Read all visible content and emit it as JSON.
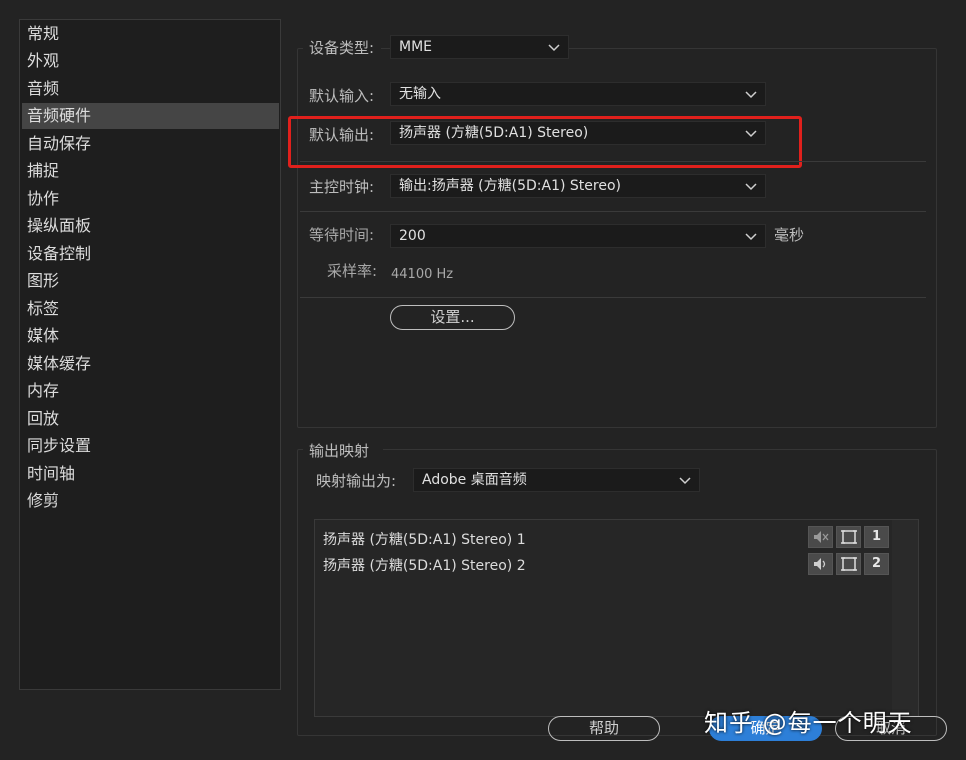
{
  "sidebar": {
    "items": [
      {
        "label": "常规"
      },
      {
        "label": "外观"
      },
      {
        "label": "音频"
      },
      {
        "label": "音频硬件"
      },
      {
        "label": "自动保存"
      },
      {
        "label": "捕捉"
      },
      {
        "label": "协作"
      },
      {
        "label": "操纵面板"
      },
      {
        "label": "设备控制"
      },
      {
        "label": "图形"
      },
      {
        "label": "标签"
      },
      {
        "label": "媒体"
      },
      {
        "label": "媒体缓存"
      },
      {
        "label": "内存"
      },
      {
        "label": "回放"
      },
      {
        "label": "同步设置"
      },
      {
        "label": "时间轴"
      },
      {
        "label": "修剪"
      }
    ],
    "active_index": 3
  },
  "device": {
    "device_type_label": "设备类型:",
    "device_type_value": "MME",
    "default_input_label": "默认输入:",
    "default_input_value": "无输入",
    "default_output_label": "默认输出:",
    "default_output_value": "扬声器 (方糖(5D:A1) Stereo)",
    "master_clock_label": "主控时钟:",
    "master_clock_value": "输出:扬声器 (方糖(5D:A1) Stereo)",
    "latency_label": "等待时间:",
    "latency_value": "200",
    "latency_unit": "毫秒",
    "sample_rate_label": "采样率:",
    "sample_rate_value": "44100 Hz",
    "settings_button": "设置..."
  },
  "output_map": {
    "section_title": "输出映射",
    "map_output_label": "映射输出为:",
    "map_output_value": "Adobe 桌面音频",
    "rows": [
      {
        "label": "扬声器 (方糖(5D:A1) Stereo) 1",
        "channel": "1"
      },
      {
        "label": "扬声器 (方糖(5D:A1) Stereo) 2",
        "channel": "2"
      }
    ]
  },
  "footer": {
    "help_button": "帮助",
    "ok_button": "确定",
    "cancel_button": "取消"
  },
  "watermark": "知乎 @每一个明天",
  "colors": {
    "highlight_box": "#e0201c",
    "primary_button": "#2d7fd8"
  }
}
